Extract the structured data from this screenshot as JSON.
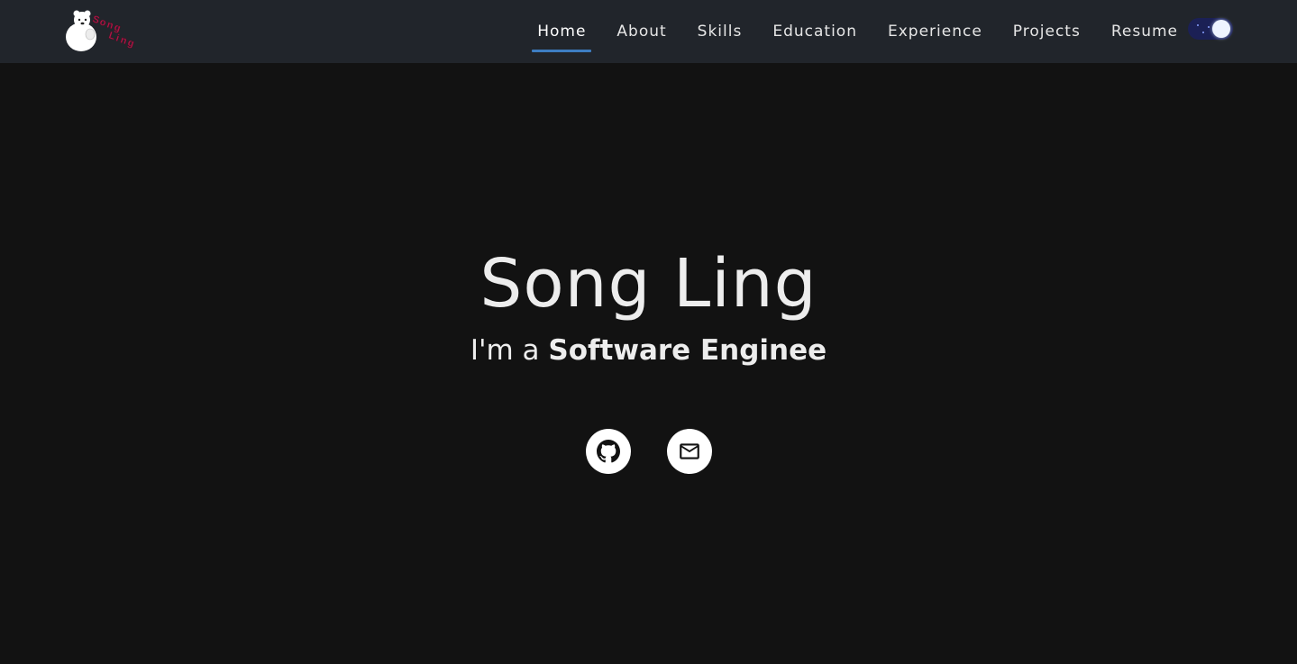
{
  "brand": {
    "logo_text": "Song Ling"
  },
  "nav": {
    "links": [
      {
        "label": "Home",
        "active": true
      },
      {
        "label": "About",
        "active": false
      },
      {
        "label": "Skills",
        "active": false
      },
      {
        "label": "Education",
        "active": false
      },
      {
        "label": "Experience",
        "active": false
      },
      {
        "label": "Projects",
        "active": false
      },
      {
        "label": "Resume",
        "active": false
      }
    ],
    "theme_toggle": {
      "state": "dark",
      "icon": "moon-toggle-icon"
    }
  },
  "hero": {
    "name": "Song Ling",
    "subtitle_prefix": "I'm a ",
    "subtitle_role": "Software Enginee"
  },
  "social": [
    {
      "name": "github",
      "icon": "github-icon"
    },
    {
      "name": "email",
      "icon": "mail-icon"
    }
  ],
  "colors": {
    "background": "#121212",
    "navbar": "#21252b",
    "accent": "#3d7dc2",
    "toggle_track": "#1b2055",
    "text": "#ececec"
  }
}
